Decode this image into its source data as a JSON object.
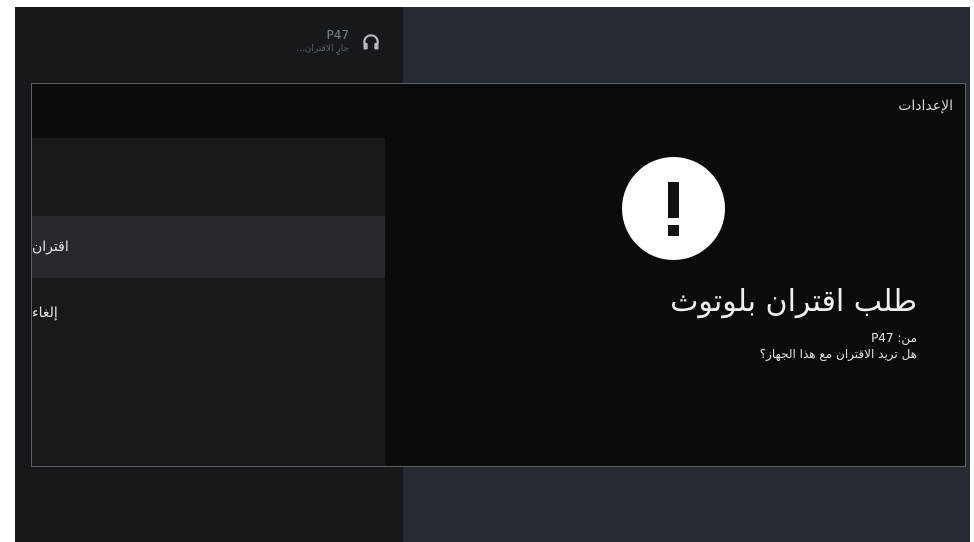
{
  "device": {
    "name": "P47",
    "status": "جارٍ الاقتران..."
  },
  "dialog": {
    "header": "الإعدادات",
    "title": "طلب اقتران بلوتوث",
    "from_line": "من: P47",
    "question": "هل تريد الاقتران مع هذا الجهاز؟",
    "actions": [
      {
        "label": "اقتران",
        "focused": true
      },
      {
        "label": "إلغاء",
        "focused": false
      }
    ],
    "alert_icon": "exclamation-icon"
  },
  "colors": {
    "screen_background": "#262b31",
    "dialog_background": "#0a0b0c",
    "action_panel": "#171a1d",
    "focused_action": "#26292d",
    "alert_circle": "#ffffff"
  }
}
